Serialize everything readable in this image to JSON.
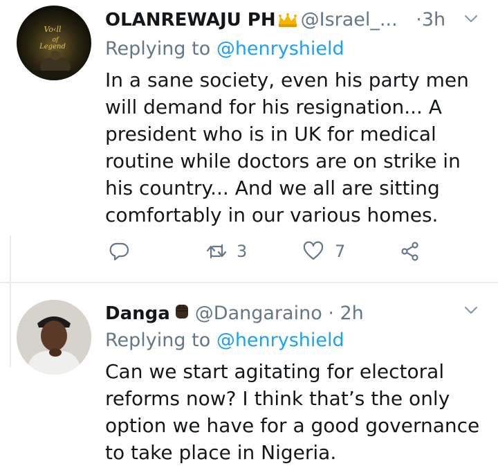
{
  "tweets": [
    {
      "name": "OLANREWAJU PH",
      "name_emoji": "crown-emoji",
      "handle": "@Israel_...",
      "separator": "·",
      "time": "3h",
      "reply_prefix": "Replying to",
      "reply_to": "@henryshield",
      "text": "In a sane society, even his party men will demand for his resignation... A president who is  in UK for medical routine while doctors are on strike in his country... And we all are sitting comfortably in our various homes.",
      "retweets": "3",
      "likes": "7"
    },
    {
      "name": "Danga",
      "name_emoji": "raised-fist-emoji",
      "handle": "@Dangaraino",
      "separator": "·",
      "time": "2h",
      "reply_prefix": "Replying to",
      "reply_to": "@henryshield",
      "text": "Can we start agitating for electoral reforms now? I think that’s the only option we have for a good governance to take place in Nigeria."
    }
  ],
  "colors": {
    "text": "#14171a",
    "secondary": "#657786",
    "link": "#1da1f2",
    "divider": "#e6ecf0",
    "crown": "#f5b400",
    "fist": "#3d2a1f"
  },
  "icons": [
    "reply-icon",
    "retweet-icon",
    "like-icon",
    "share-icon",
    "chevron-down-icon"
  ]
}
